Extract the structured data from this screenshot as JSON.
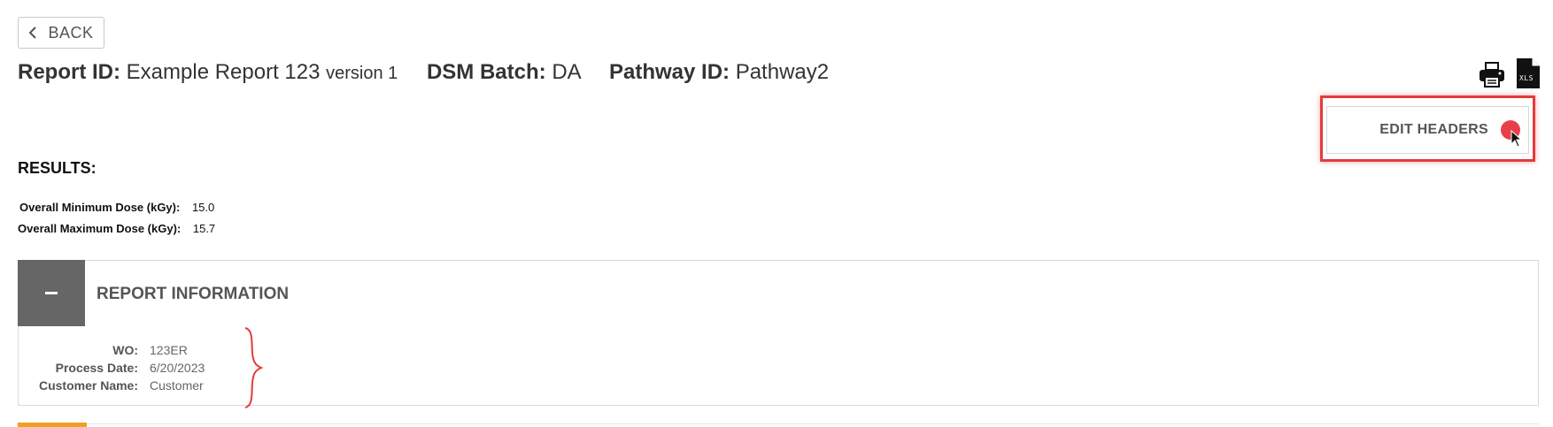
{
  "toolbar": {
    "back_label": "BACK",
    "back_icon": "chevron-left-icon",
    "print_icon": "printer-icon",
    "xls_icon": "xls-file-icon",
    "xls_text": "XLS",
    "edit_headers_label": "EDIT HEADERS"
  },
  "header": {
    "report_id_label": "Report ID:",
    "report_id_value": "Example Report 123",
    "version_text": "version 1",
    "dsm_batch_label": "DSM Batch:",
    "dsm_batch_value": "DA",
    "pathway_id_label": "Pathway ID:",
    "pathway_id_value": "Pathway2"
  },
  "results": {
    "title": "RESULTS:",
    "min_dose_label": "Overall Minimum Dose (kGy):",
    "min_dose_value": "15.0",
    "max_dose_label": "Overall Maximum Dose (kGy):",
    "max_dose_value": "15.7"
  },
  "report_information": {
    "title": "REPORT INFORMATION",
    "collapse_icon": "minus-icon",
    "rows": [
      {
        "label": "WO:",
        "value": "123ER"
      },
      {
        "label": "Process Date:",
        "value": "6/20/2023"
      },
      {
        "label": "Customer Name:",
        "value": "Customer"
      }
    ]
  },
  "annotation": {
    "highlight_color": "#e53a3a",
    "accent_color": "#f0a020"
  }
}
